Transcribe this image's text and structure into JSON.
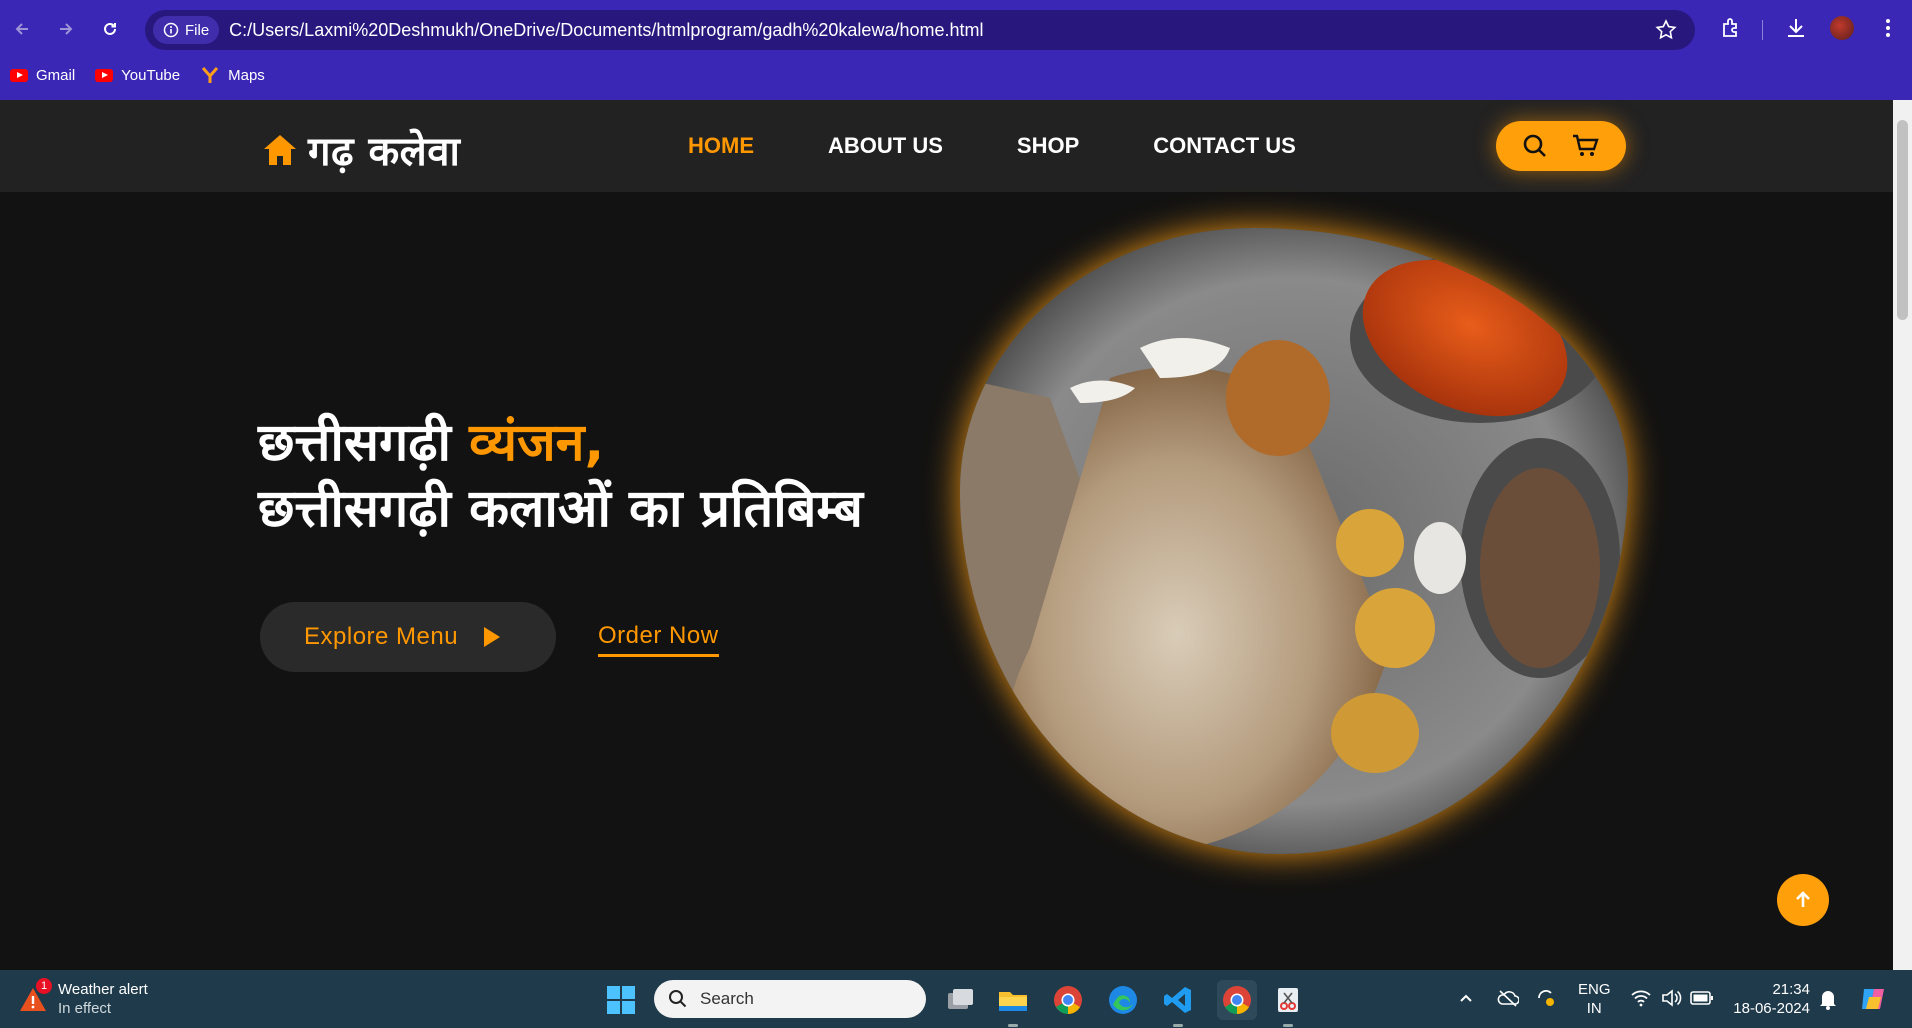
{
  "browser": {
    "file_label": "File",
    "url": "C:/Users/Laxmi%20Deshmukh/OneDrive/Documents/htmlprogram/gadh%20kalewa/home.html",
    "bookmarks": [
      "Gmail",
      "YouTube",
      "Maps"
    ]
  },
  "site": {
    "logo": "गढ़ कलेवा",
    "menu": [
      "HOME",
      "ABOUT US",
      "SHOP",
      "CONTACT US"
    ],
    "active_menu": "HOME"
  },
  "hero": {
    "line1_a": "छत्तीसगढ़ी ",
    "line1_b": "व्यंजन,",
    "line2": "छत्तीसगढ़ी कलाओं का प्रतिबिम्ब",
    "explore_label": "Explore Menu",
    "order_label": "Order Now"
  },
  "taskbar": {
    "weather_title": "Weather alert",
    "weather_sub": "In effect",
    "weather_badge": "1",
    "search_label": "Search",
    "lang_line1": "ENG",
    "lang_line2": "IN",
    "time": "21:34",
    "date": "18-06-2024"
  },
  "colors": {
    "accent": "#ff9800",
    "browser_bar": "#3a27b5",
    "header_bg": "#222222",
    "hero_bg": "#121212"
  }
}
